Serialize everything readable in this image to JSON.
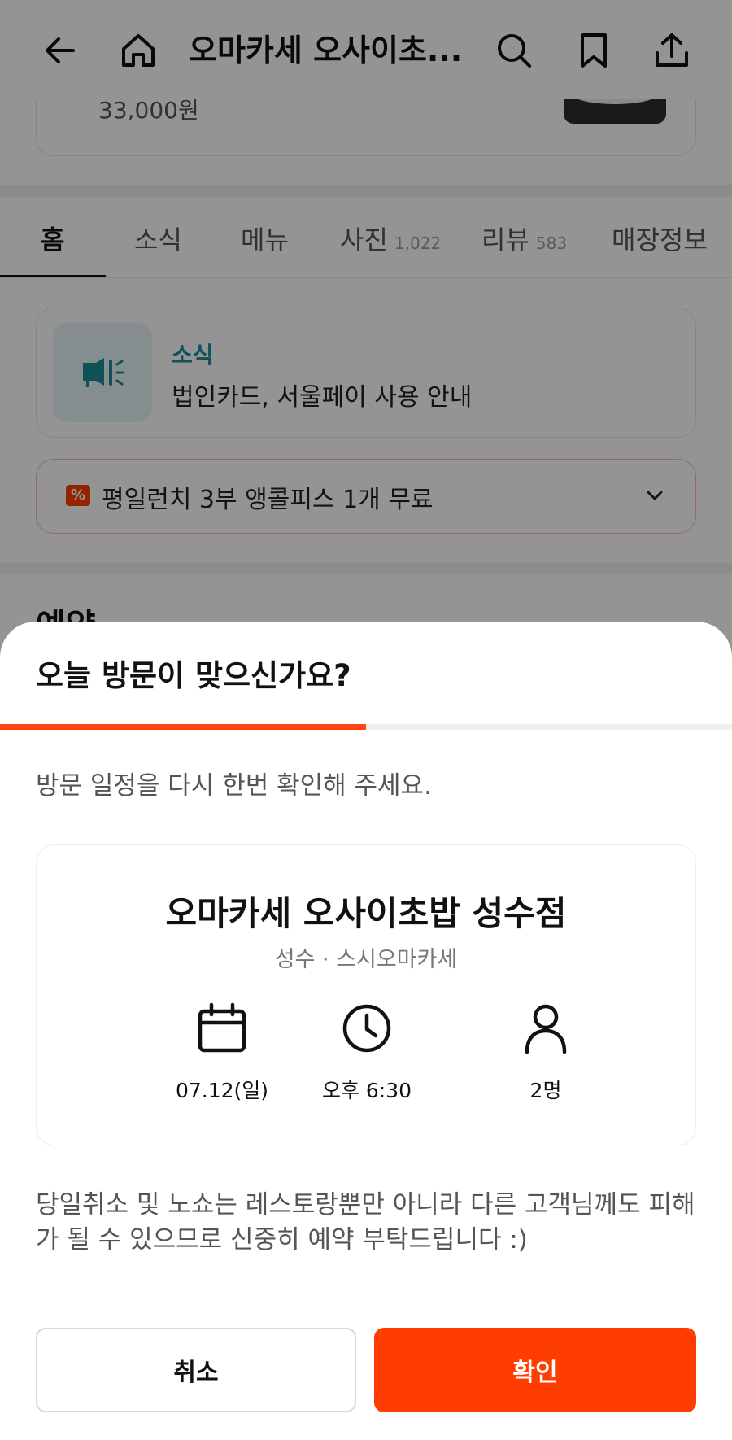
{
  "header": {
    "title": "오마카세 오사이초...",
    "back_icon": "arrow-left-icon",
    "home_icon": "home-icon",
    "search_icon": "search-icon",
    "bookmark_icon": "bookmark-icon",
    "share_icon": "share-icon"
  },
  "menu_item": {
    "price": "33,000원"
  },
  "tabs": [
    {
      "label": "홈",
      "count": ""
    },
    {
      "label": "소식",
      "count": ""
    },
    {
      "label": "메뉴",
      "count": ""
    },
    {
      "label": "사진",
      "count": "1,022"
    },
    {
      "label": "리뷰",
      "count": "583"
    },
    {
      "label": "매장정보",
      "count": ""
    }
  ],
  "news": {
    "label": "소식",
    "text": "법인카드, 서울페이 사용 안내"
  },
  "promo": {
    "text": "평일런치 3부 앵콜피스 1개 무료"
  },
  "section": {
    "title": "예약"
  },
  "sheet": {
    "title": "오늘 방문이 맞으신가요?",
    "progress": 0.5,
    "subtitle": "방문 일정을 다시 한번 확인해 주세요.",
    "restaurant": {
      "name": "오마카세 오사이초밥 성수점",
      "category": "성수 · 스시오마카세"
    },
    "date": "07.12(일)",
    "time": "오후 6:30",
    "party": "2명",
    "notice": "당일취소 및 노쇼는 레스토랑뿐만 아니라 다른 고객님께도 피해가 될 수 있으므로 신중히 예약 부탁드립니다 :)",
    "cancel_label": "취소",
    "confirm_label": "확인"
  },
  "colors": {
    "accent": "#ff3d00",
    "news_teal": "#1a8c9a",
    "dim_overlay": "rgba(0,0,0,0.42)"
  }
}
